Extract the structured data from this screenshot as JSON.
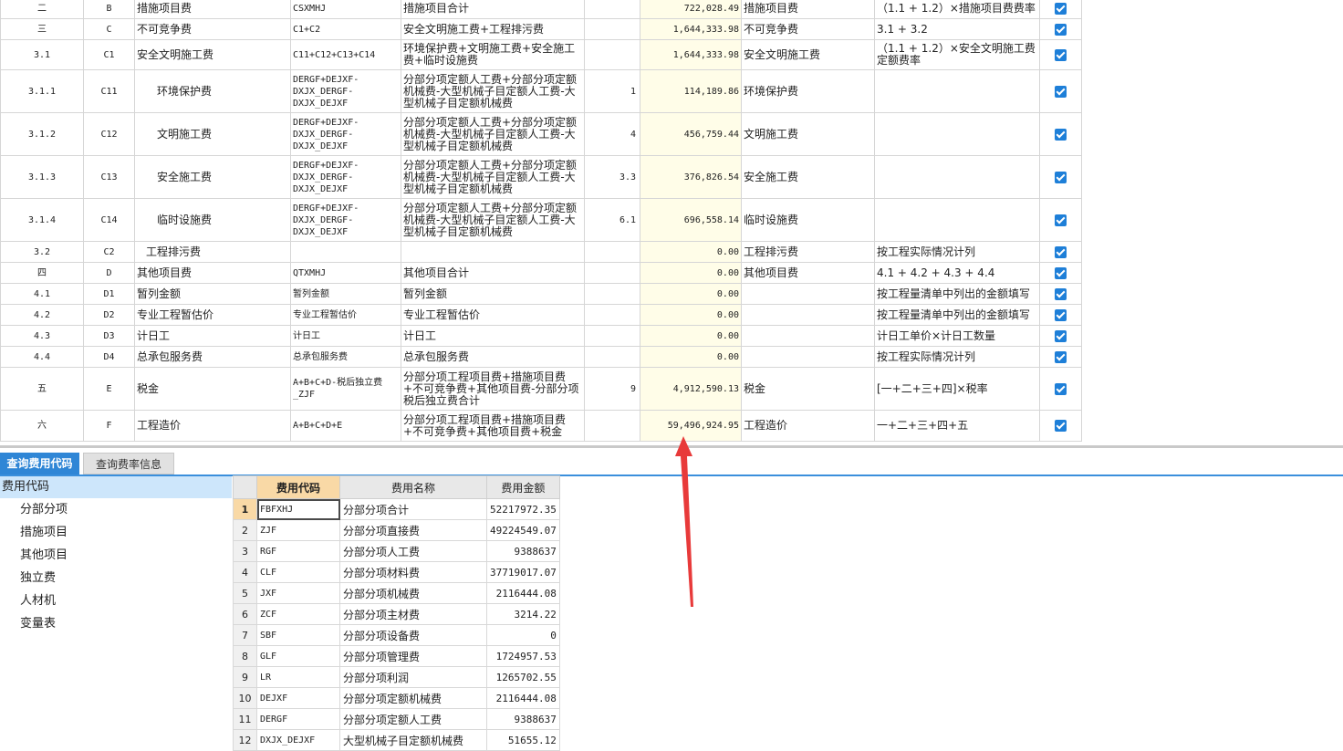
{
  "fee_rows": [
    {
      "seq": "二",
      "code": "B",
      "name": "措施项目费",
      "level": 0,
      "base": "CSXMHJ",
      "base_desc": "措施项目合计",
      "rate": "",
      "amount": "722,028.49",
      "fee_type": "措施项目费",
      "remark": "（1.1 + 1.2）×措施项目费费率",
      "checked": true
    },
    {
      "seq": "三",
      "code": "C",
      "name": "不可竞争费",
      "level": 0,
      "base": "C1+C2",
      "base_desc": "安全文明施工费+工程排污费",
      "rate": "",
      "amount": "1,644,333.98",
      "fee_type": "不可竞争费",
      "remark": "3.1 + 3.2",
      "checked": true
    },
    {
      "seq": "3.1",
      "code": "C1",
      "name": "安全文明施工费",
      "level": 0,
      "base": "C11+C12+C13+C14",
      "base_desc": "环境保护费+文明施工费+安全施工费+临时设施费",
      "rate": "",
      "amount": "1,644,333.98",
      "fee_type": "安全文明施工费",
      "remark": "（1.1 + 1.2）×安全文明施工费定额费率",
      "checked": true
    },
    {
      "seq": "3.1.1",
      "code": "C11",
      "name": "环境保护费",
      "level": 2,
      "base": "DERGF+DEJXF-DXJX_DERGF-DXJX_DEJXF",
      "base_desc": "分部分项定额人工费+分部分项定额机械费-大型机械子目定额人工费-大型机械子目定额机械费",
      "rate": "1",
      "amount": "114,189.86",
      "fee_type": "环境保护费",
      "remark": "",
      "checked": true
    },
    {
      "seq": "3.1.2",
      "code": "C12",
      "name": "文明施工费",
      "level": 2,
      "base": "DERGF+DEJXF-DXJX_DERGF-DXJX_DEJXF",
      "base_desc": "分部分项定额人工费+分部分项定额机械费-大型机械子目定额人工费-大型机械子目定额机械费",
      "rate": "4",
      "amount": "456,759.44",
      "fee_type": "文明施工费",
      "remark": "",
      "checked": true
    },
    {
      "seq": "3.1.3",
      "code": "C13",
      "name": "安全施工费",
      "level": 2,
      "base": "DERGF+DEJXF-DXJX_DERGF-DXJX_DEJXF",
      "base_desc": "分部分项定额人工费+分部分项定额机械费-大型机械子目定额人工费-大型机械子目定额机械费",
      "rate": "3.3",
      "amount": "376,826.54",
      "fee_type": "安全施工费",
      "remark": "",
      "checked": true
    },
    {
      "seq": "3.1.4",
      "code": "C14",
      "name": "临时设施费",
      "level": 2,
      "base": "DERGF+DEJXF-DXJX_DERGF-DXJX_DEJXF",
      "base_desc": "分部分项定额人工费+分部分项定额机械费-大型机械子目定额人工费-大型机械子目定额机械费",
      "rate": "6.1",
      "amount": "696,558.14",
      "fee_type": "临时设施费",
      "remark": "",
      "checked": true
    },
    {
      "seq": "3.2",
      "code": "C2",
      "name": "工程排污费",
      "level": 1,
      "base": "",
      "base_desc": "",
      "rate": "",
      "amount": "0.00",
      "fee_type": "工程排污费",
      "remark": "按工程实际情况计列",
      "checked": true
    },
    {
      "seq": "四",
      "code": "D",
      "name": "其他项目费",
      "level": 0,
      "base": "QTXMHJ",
      "base_desc": "其他项目合计",
      "rate": "",
      "amount": "0.00",
      "fee_type": "其他项目费",
      "remark": "4.1 + 4.2 + 4.3 + 4.4",
      "checked": true
    },
    {
      "seq": "4.1",
      "code": "D1",
      "name": "暂列金额",
      "level": 0,
      "base": "暂列金额",
      "base_desc": "暂列金额",
      "rate": "",
      "amount": "0.00",
      "fee_type": "",
      "remark": "按工程量清单中列出的金额填写",
      "checked": true
    },
    {
      "seq": "4.2",
      "code": "D2",
      "name": "专业工程暂估价",
      "level": 0,
      "base": "专业工程暂估价",
      "base_desc": "专业工程暂估价",
      "rate": "",
      "amount": "0.00",
      "fee_type": "",
      "remark": "按工程量清单中列出的金额填写",
      "checked": true
    },
    {
      "seq": "4.3",
      "code": "D3",
      "name": "计日工",
      "level": 0,
      "base": "计日工",
      "base_desc": "计日工",
      "rate": "",
      "amount": "0.00",
      "fee_type": "",
      "remark": "计日工单价×计日工数量",
      "checked": true
    },
    {
      "seq": "4.4",
      "code": "D4",
      "name": "总承包服务费",
      "level": 0,
      "base": "总承包服务费",
      "base_desc": "总承包服务费",
      "rate": "",
      "amount": "0.00",
      "fee_type": "",
      "remark": "按工程实际情况计列",
      "checked": true
    },
    {
      "seq": "五",
      "code": "E",
      "name": "税金",
      "level": 0,
      "base": "A+B+C+D-税后独立费_ZJF",
      "base_desc": "分部分项工程项目费+措施项目费+不可竞争费+其他项目费-分部分项税后独立费合计",
      "rate": "9",
      "amount": "4,912,590.13",
      "fee_type": "税金",
      "remark": "[一+二+三+四]×税率",
      "checked": true
    },
    {
      "seq": "六",
      "code": "F",
      "name": "工程造价",
      "level": 0,
      "base": "A+B+C+D+E",
      "base_desc": "分部分项工程项目费+措施项目费+不可竞争费+其他项目费+税金",
      "rate": "",
      "amount": "59,496,924.95",
      "fee_type": "工程造价",
      "remark": "一+二+三+四+五",
      "checked": true
    }
  ],
  "tabs": [
    {
      "label": "查询费用代码",
      "active": true
    },
    {
      "label": "查询费率信息",
      "active": false
    }
  ],
  "tree": {
    "root": "费用代码",
    "items": [
      "分部分项",
      "措施项目",
      "其他项目",
      "独立费",
      "人材机",
      "变量表"
    ]
  },
  "code_table": {
    "headers": [
      "费用代码",
      "费用名称",
      "费用金额"
    ],
    "rows": [
      {
        "num": "1",
        "code": "FBFXHJ",
        "name": "分部分项合计",
        "amount": "52217972.35"
      },
      {
        "num": "2",
        "code": "ZJF",
        "name": "分部分项直接费",
        "amount": "49224549.07"
      },
      {
        "num": "3",
        "code": "RGF",
        "name": "分部分项人工费",
        "amount": "9388637"
      },
      {
        "num": "4",
        "code": "CLF",
        "name": "分部分项材料费",
        "amount": "37719017.07"
      },
      {
        "num": "5",
        "code": "JXF",
        "name": "分部分项机械费",
        "amount": "2116444.08"
      },
      {
        "num": "6",
        "code": "ZCF",
        "name": "分部分项主材费",
        "amount": "3214.22"
      },
      {
        "num": "7",
        "code": "SBF",
        "name": "分部分项设备费",
        "amount": "0"
      },
      {
        "num": "8",
        "code": "GLF",
        "name": "分部分项管理费",
        "amount": "1724957.53"
      },
      {
        "num": "9",
        "code": "LR",
        "name": "分部分项利润",
        "amount": "1265702.55"
      },
      {
        "num": "10",
        "code": "DEJXF",
        "name": "分部分项定额机械费",
        "amount": "2116444.08"
      },
      {
        "num": "11",
        "code": "DERGF",
        "name": "分部分项定额人工费",
        "amount": "9388637"
      },
      {
        "num": "12",
        "code": "DXJX_DEJXF",
        "name": "大型机械子目定额机械费",
        "amount": "51655.12"
      }
    ]
  },
  "colors": {
    "accent": "#2f86d6",
    "checkbox": "#1e7fd8",
    "amount_bg": "#fffde8",
    "arrow": "#e83a3a",
    "selected_header": "#f9d9a6"
  }
}
